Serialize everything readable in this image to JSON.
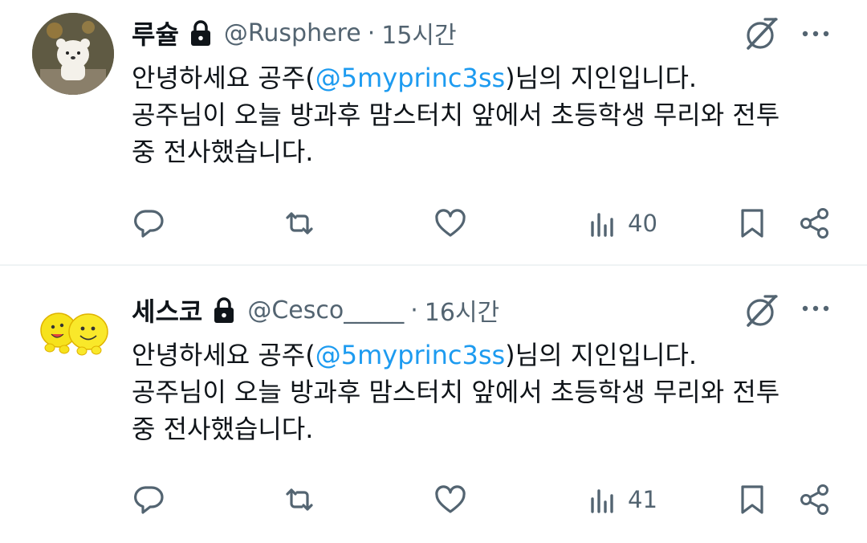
{
  "tweets": [
    {
      "name": "루슐",
      "handle": "@Rusphere",
      "separator": "·",
      "time": "15시간",
      "body": {
        "pre_mention": "안녕하세요 공주(",
        "mention": "@5myprinc3ss",
        "post_mention": ")님의 지인입니다.",
        "line2": "공주님이 오늘 방과후 맘스터치 앞에서 초등학생 무리와 전투",
        "line3": "중 전사했습니다."
      },
      "views": "40",
      "avatar_icon": "bear-avatar-icon"
    },
    {
      "name": "세스코",
      "handle": "@Cesco_____",
      "separator": "·",
      "time": "16시간",
      "body": {
        "pre_mention": "안녕하세요 공주(",
        "mention": "@5myprinc3ss",
        "post_mention": ")님의 지인입니다.",
        "line2": "공주님이 오늘 방과후 맘스터치 앞에서 초등학생 무리와 전투",
        "line3": "중 전사했습니다."
      },
      "views": "41",
      "avatar_icon": "smiley-faces-avatar-icon"
    }
  ],
  "colors": {
    "text": "#0f1419",
    "secondary": "#536471",
    "mention": "#1d9bf0",
    "divider": "#eff3f4"
  }
}
